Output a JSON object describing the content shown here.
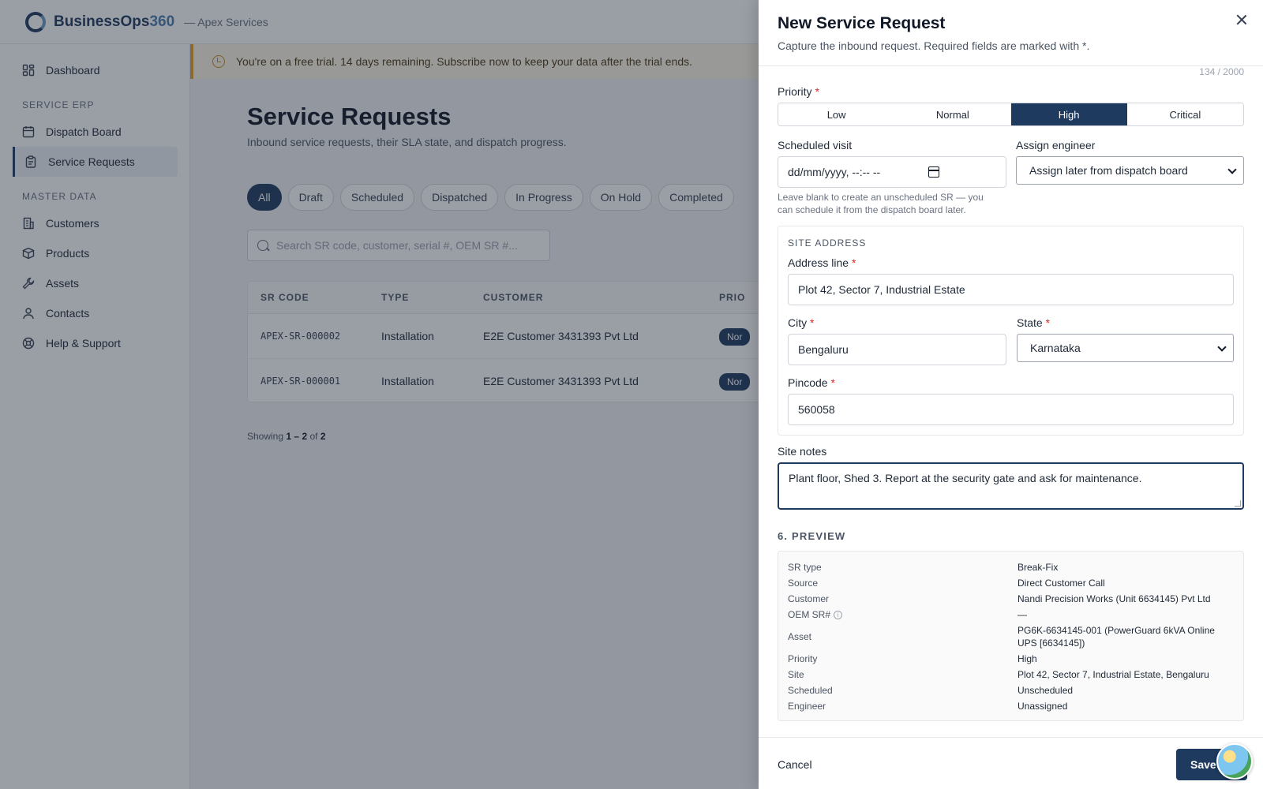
{
  "app": {
    "brand_main": "BusinessOps",
    "brand_accent": "360",
    "org": "— Apex Services"
  },
  "sidebar": {
    "dashboard": "Dashboard",
    "section_service": "SERVICE ERP",
    "dispatch_board": "Dispatch Board",
    "service_requests": "Service Requests",
    "section_master": "MASTER DATA",
    "customers": "Customers",
    "products": "Products",
    "assets": "Assets",
    "contacts": "Contacts",
    "help": "Help & Support"
  },
  "trial_banner": "You're on a free trial. 14 days remaining. Subscribe now to keep your data after the trial ends.",
  "page": {
    "title": "Service Requests",
    "subtitle": "Inbound service requests, their SLA state, and dispatch progress.",
    "filters": [
      "All",
      "Draft",
      "Scheduled",
      "Dispatched",
      "In Progress",
      "On Hold",
      "Completed"
    ],
    "search_placeholder": "Search SR code, customer, serial #, OEM SR #...",
    "columns": [
      "SR CODE",
      "TYPE",
      "CUSTOMER",
      "PRIO"
    ],
    "rows": [
      {
        "code": "APEX-SR-000002",
        "type": "Installation",
        "customer": "E2E Customer 3431393 Pvt Ltd",
        "priority": "Nor"
      },
      {
        "code": "APEX-SR-000001",
        "type": "Installation",
        "customer": "E2E Customer 3431393 Pvt Ltd",
        "priority": "Nor"
      }
    ],
    "showing_prefix": "Showing",
    "showing_from": "1",
    "showing_dash": "–",
    "showing_to": "2",
    "showing_of": "of",
    "showing_total": "2"
  },
  "drawer": {
    "title": "New Service Request",
    "subtitle": "Capture the inbound request. Required fields are marked with *.",
    "char_counter": "134 / 2000",
    "priority_label": "Priority",
    "required_mark": "*",
    "priority_options": [
      "Low",
      "Normal",
      "High",
      "Critical"
    ],
    "scheduled_label": "Scheduled visit",
    "scheduled_placeholder": "dd/mm/yyyy, --:-- --",
    "scheduled_help_1": "Leave blank to create an unscheduled SR — you",
    "scheduled_help_2": "can schedule it from the dispatch board later.",
    "engineer_label": "Assign engineer",
    "engineer_value": "Assign later from dispatch board",
    "site_section": "SITE ADDRESS",
    "address_label": "Address line",
    "address_value": "Plot 42, Sector 7, Industrial Estate",
    "city_label": "City",
    "city_value": "Bengaluru",
    "state_label": "State",
    "state_value": "Karnataka",
    "pincode_label": "Pincode",
    "pincode_value": "560058",
    "notes_label": "Site notes",
    "notes_value": "Plant floor, Shed 3. Report at the security gate and ask for maintenance.",
    "preview_heading": "6. PREVIEW",
    "preview": [
      {
        "k": "SR type",
        "v": "Break-Fix"
      },
      {
        "k": "Source",
        "v": "Direct Customer Call"
      },
      {
        "k": "Customer",
        "v": "Nandi Precision Works (Unit 6634145) Pvt Ltd"
      },
      {
        "k": "OEM SR#",
        "v": "—"
      },
      {
        "k": "Asset",
        "v": "PG6K-6634145-001 (PowerGuard 6kVA Online UPS [6634145])"
      },
      {
        "k": "Priority",
        "v": "High"
      },
      {
        "k": "Site",
        "v": "Plot 42, Sector 7, Industrial Estate, Bengaluru"
      },
      {
        "k": "Scheduled",
        "v": "Unscheduled"
      },
      {
        "k": "Engineer",
        "v": "Unassigned"
      }
    ],
    "info_glyph": "i",
    "cancel": "Cancel",
    "save": "Save"
  },
  "colors": {
    "primary": "#1e3a5f",
    "required": "#dc2626",
    "banner_bg": "#fdf6e6"
  }
}
